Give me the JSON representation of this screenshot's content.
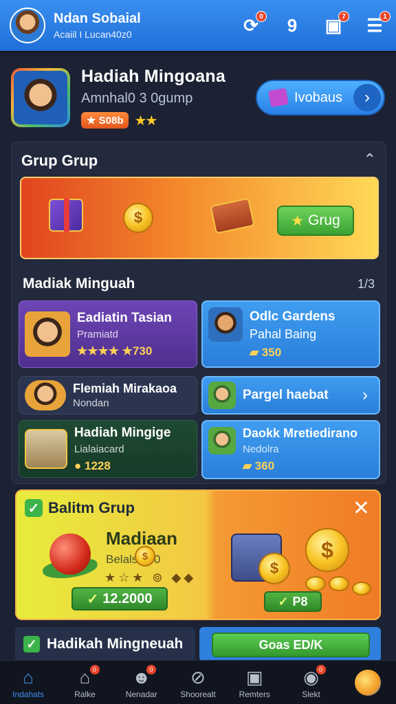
{
  "header": {
    "user_name": "Ndan Sobaial",
    "user_sub": "Acaiil I Lucan40z0",
    "icons": [
      {
        "name": "refresh-icon",
        "glyph": "⟳",
        "badge": "0"
      },
      {
        "name": "location-icon",
        "glyph": "9",
        "badge": ""
      },
      {
        "name": "clipboard-icon",
        "glyph": "▣",
        "badge": "7"
      },
      {
        "name": "menu-icon",
        "glyph": "☰",
        "badge": "1"
      }
    ]
  },
  "profile": {
    "title": "Hadiah Mingoana",
    "subtitle": "Amnhal0 3 0gump",
    "coins": "S08b",
    "stars": "★★",
    "promo_label": "Ivobaus"
  },
  "group": {
    "heading": "Grup Grup",
    "button_label": "Grug"
  },
  "weekly": {
    "heading": "Madiak Minguah",
    "count": "1/3",
    "cards": [
      {
        "title": "Eadiatin Tasian",
        "sub": "Pramiatd",
        "value": "★★★★  ★730"
      },
      {
        "title": "Odlc Gardens",
        "sub": "Pahal Baing",
        "value": "350"
      },
      {
        "title": "Flemiah Mirakaoa",
        "sub": "Nondan",
        "value": ""
      },
      {
        "title": "Pargel haebat",
        "sub": "",
        "value": ""
      },
      {
        "title": "Hadiah Mingige",
        "sub": "Lialaiacard",
        "value": "1228"
      },
      {
        "title": "Daokk Mretiedirano",
        "sub": "Nedolra",
        "value": "360"
      }
    ]
  },
  "reward": {
    "title": "Balitm Grup",
    "main_title": "Madiaan",
    "desc": "Belalsa  30",
    "stars_row": "★☆★ ⊚ ◆◆",
    "amount": "12.2000",
    "pay_label": "P8"
  },
  "bottom": {
    "label": "Hadikah Mingneuah",
    "action": "Goas ED/K"
  },
  "nav": [
    {
      "label": "Indahats",
      "glyph": "⌂",
      "badge": "",
      "active": true
    },
    {
      "label": "Ralke",
      "glyph": "⌂",
      "badge": "0",
      "active": false
    },
    {
      "label": "Nenadar",
      "glyph": "☻",
      "badge": "0",
      "active": false
    },
    {
      "label": "Shoorealt",
      "glyph": "⊘",
      "badge": "",
      "active": false
    },
    {
      "label": "Remters",
      "glyph": "▣",
      "badge": "",
      "active": false
    },
    {
      "label": "Slekt",
      "glyph": "◉",
      "badge": "0",
      "active": false
    },
    {
      "label": "",
      "glyph": "",
      "badge": "",
      "active": false
    }
  ],
  "colors": {
    "topbar": "#2a80e6",
    "background": "#1c2233",
    "accent_green": "#3db44a",
    "accent_orange": "#f07b26"
  }
}
